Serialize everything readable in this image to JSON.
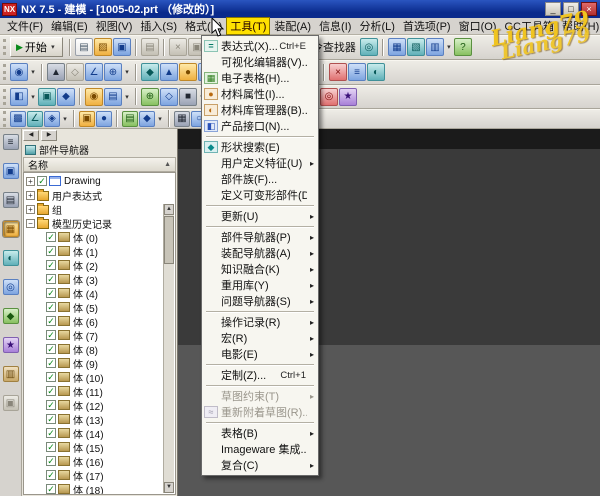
{
  "window": {
    "title": "NX 7.5 - 建模 - [1005-02.prt （修改的）]",
    "logo": "NX",
    "min": "_",
    "max": "□",
    "close": "×"
  },
  "colors": {
    "titlebar_blue": "#0a2a8c",
    "menu_highlight_yellow": "#ffe100",
    "graphics_dark": "#3a3a3a",
    "graphics_light": "#575757",
    "watermark_yellow": "#f0c420"
  },
  "watermark": {
    "text": "Liang79"
  },
  "menu_bar": {
    "items": [
      {
        "id": "file",
        "label": "文件(F)"
      },
      {
        "id": "edit",
        "label": "编辑(E)"
      },
      {
        "id": "view",
        "label": "视图(V)"
      },
      {
        "id": "insert",
        "label": "插入(S)"
      },
      {
        "id": "format",
        "label": "格式(R)"
      },
      {
        "id": "tools",
        "label": "工具(T)",
        "active": true
      },
      {
        "id": "assemblies",
        "label": "装配(A)"
      },
      {
        "id": "information",
        "label": "信息(I)"
      },
      {
        "id": "analysis",
        "label": "分析(L)"
      },
      {
        "id": "preferences",
        "label": "首选项(P)"
      },
      {
        "id": "window",
        "label": "窗口(O)"
      },
      {
        "id": "gc-toolbox",
        "label": "GC工具箱"
      },
      {
        "id": "help",
        "label": "帮助(H)"
      }
    ]
  },
  "tools_menu": {
    "items": [
      {
        "label": "表达式(X)...",
        "shortcut": "Ctrl+E",
        "icon": "expr"
      },
      {
        "label": "可视化编辑器(V)..."
      },
      {
        "label": "电子表格(H)...",
        "icon": "sheet"
      },
      {
        "label": "材料属性(I)...",
        "icon": "material"
      },
      {
        "label": "材料库管理器(B)...",
        "icon": "matlib"
      },
      {
        "label": "产品接口(N)...",
        "icon": "product"
      },
      {
        "sep": true
      },
      {
        "label": "形状搜索(E)",
        "icon": "shape"
      },
      {
        "label": "用户定义特征(U)",
        "sub": true
      },
      {
        "label": "部件族(F)..."
      },
      {
        "label": "定义可变形部件(D)..."
      },
      {
        "sep": true
      },
      {
        "label": "更新(U)",
        "sub": true
      },
      {
        "sep": true
      },
      {
        "label": "部件导航器(P)",
        "sub": true
      },
      {
        "label": "装配导航器(A)",
        "sub": true
      },
      {
        "label": "知识融合(K)",
        "sub": true
      },
      {
        "label": "重用库(Y)",
        "sub": true
      },
      {
        "label": "问题导航器(S)",
        "sub": true
      },
      {
        "sep": true
      },
      {
        "label": "操作记录(R)",
        "sub": true
      },
      {
        "label": "宏(R)",
        "sub": true
      },
      {
        "label": "电影(E)",
        "sub": true
      },
      {
        "sep": true
      },
      {
        "label": "定制(Z)...",
        "shortcut": "Ctrl+1"
      },
      {
        "sep": true
      },
      {
        "label": "草图约束(T)",
        "sub": true,
        "disabled": true
      },
      {
        "label": "重新附着草图(R)...",
        "icon": "reattach",
        "disabled": true
      },
      {
        "sep": true
      },
      {
        "label": "表格(B)",
        "sub": true
      },
      {
        "label": "Imageware 集成..."
      },
      {
        "label": "复合(C)",
        "sub": true
      }
    ]
  },
  "toolbars": {
    "row1": [
      {
        "t": "grip"
      },
      {
        "t": "start",
        "label": "开始",
        "n": "start-button"
      },
      {
        "t": "sep"
      },
      {
        "t": "ic",
        "n": "new-part-icon",
        "c": "c8",
        "g": "▤"
      },
      {
        "t": "ic",
        "n": "open-icon",
        "c": "c1",
        "g": "▨"
      },
      {
        "t": "ic",
        "n": "save-icon",
        "c": "c0",
        "g": "▣"
      },
      {
        "t": "sep"
      },
      {
        "t": "ic",
        "n": "print-icon",
        "c": "c4",
        "g": "▤"
      },
      {
        "t": "sep"
      },
      {
        "t": "ic",
        "n": "cut-icon",
        "c": "c4",
        "g": "×"
      },
      {
        "t": "ic",
        "n": "copy-icon",
        "c": "c4",
        "g": "▣"
      },
      {
        "t": "ic",
        "n": "paste-icon",
        "c": "c4",
        "g": "▥"
      },
      {
        "t": "sep"
      },
      {
        "t": "input",
        "n": "command-finder-input"
      },
      {
        "t": "label",
        "label": "命令查找器",
        "n": "command-finder-label"
      },
      {
        "t": "ic",
        "n": "command-finder-icon",
        "c": "c3",
        "g": "◎"
      },
      {
        "t": "sep"
      },
      {
        "t": "ic",
        "n": "new-window-icon",
        "c": "c0",
        "g": "▦"
      },
      {
        "t": "ic",
        "n": "cascade-windows-icon",
        "c": "c3",
        "g": "▧"
      },
      {
        "t": "ic",
        "n": "tile-windows-icon",
        "c": "c0",
        "g": "▥"
      },
      {
        "t": "car"
      },
      {
        "t": "ic",
        "n": "help-icon",
        "c": "c2",
        "g": "?"
      }
    ],
    "row2": [
      {
        "t": "grip"
      },
      {
        "t": "ic",
        "n": "snap-point-icon",
        "c": "c0",
        "g": "◉"
      },
      {
        "t": "car"
      },
      {
        "t": "sep"
      },
      {
        "t": "ic",
        "n": "select-icon",
        "c": "c9",
        "g": "▲"
      },
      {
        "t": "ic",
        "n": "selection-filter-icon",
        "c": "c4",
        "g": "◇"
      },
      {
        "t": "ic",
        "n": "angle-snap-icon",
        "c": "c0",
        "g": "∠"
      },
      {
        "t": "ic",
        "n": "point-constructor-icon",
        "c": "c0",
        "g": "⊕"
      },
      {
        "t": "car"
      },
      {
        "t": "sep"
      },
      {
        "t": "ic",
        "n": "datum-plane-icon",
        "c": "c3",
        "g": "◆"
      },
      {
        "t": "ic",
        "n": "datum-axis-icon",
        "c": "c0",
        "g": "▲"
      },
      {
        "t": "ic",
        "n": "sphere-icon",
        "c": "c1",
        "g": "●"
      },
      {
        "t": "ic",
        "n": "datum-csys-icon",
        "c": "c0",
        "g": "◧"
      },
      {
        "t": "car"
      },
      {
        "t": "sep"
      },
      {
        "t": "ic",
        "n": "measure-icon",
        "c": "c2",
        "g": "✓"
      },
      {
        "t": "ic",
        "n": "grid-icon",
        "c": "c0",
        "g": "▦"
      },
      {
        "t": "ic",
        "n": "gem-icon",
        "c": "c6",
        "g": "◈"
      },
      {
        "t": "ic",
        "n": "pattern-icon",
        "c": "c0",
        "g": "▩"
      },
      {
        "t": "car"
      },
      {
        "t": "sep"
      },
      {
        "t": "ic",
        "n": "delete-icon",
        "c": "c5",
        "g": "×"
      },
      {
        "t": "ic",
        "n": "list-icon",
        "c": "c0",
        "g": "≡"
      },
      {
        "t": "ic",
        "n": "half-section-icon",
        "c": "c3",
        "g": "◐"
      }
    ],
    "row3": [
      {
        "t": "grip"
      },
      {
        "t": "ic",
        "n": "csys-view-icon",
        "c": "c0",
        "g": "◧"
      },
      {
        "t": "car"
      },
      {
        "t": "ic",
        "n": "shaded-view-icon",
        "c": "c3",
        "g": "▣"
      },
      {
        "t": "ic",
        "n": "wireframe-view-icon",
        "c": "c0",
        "g": "◆"
      },
      {
        "t": "sep"
      },
      {
        "t": "ic",
        "n": "orient-view-icon",
        "c": "c1",
        "g": "◉"
      },
      {
        "t": "ic",
        "n": "fit-view-icon",
        "c": "c0",
        "g": "▤"
      },
      {
        "t": "car"
      },
      {
        "t": "sep"
      },
      {
        "t": "ic",
        "n": "extrude-icon",
        "c": "c2",
        "g": "⊕"
      },
      {
        "t": "ic",
        "n": "revolve-icon",
        "c": "c0",
        "g": "◇"
      },
      {
        "t": "ic",
        "n": "block-icon",
        "c": "c9",
        "g": "■"
      },
      {
        "t": "car"
      },
      {
        "t": "sep"
      },
      {
        "t": "ic",
        "n": "trim-body-icon",
        "c": "c0",
        "g": "▲"
      },
      {
        "t": "ic",
        "n": "unite-icon",
        "c": "c3",
        "g": "●"
      },
      {
        "t": "ic",
        "n": "subtract-icon",
        "c": "c0",
        "g": "▧"
      },
      {
        "t": "sep"
      },
      {
        "t": "ic",
        "n": "edit-feature-icon",
        "c": "c5",
        "g": "◆"
      },
      {
        "t": "ic",
        "n": "delete-face-icon",
        "c": "c5",
        "g": "×"
      },
      {
        "t": "ic",
        "n": "synchronous-icon",
        "c": "c5",
        "g": "◎"
      },
      {
        "t": "ic",
        "n": "move-face-icon",
        "c": "c6",
        "g": "★"
      }
    ],
    "row4": [
      {
        "t": "grip"
      },
      {
        "t": "ic",
        "n": "sketch-icon",
        "c": "c0",
        "g": "▩"
      },
      {
        "t": "ic",
        "n": "sketch-line-icon",
        "c": "c3",
        "g": "∠"
      },
      {
        "t": "ic",
        "n": "sketch-profile-icon",
        "c": "c0",
        "g": "◈"
      },
      {
        "t": "car"
      },
      {
        "t": "sep"
      },
      {
        "t": "ic",
        "n": "arc-icon",
        "c": "c1",
        "g": "▣"
      },
      {
        "t": "ic",
        "n": "circle-icon",
        "c": "c0",
        "g": "●"
      },
      {
        "t": "sep"
      },
      {
        "t": "ic",
        "n": "fillet-icon",
        "c": "c2",
        "g": "▤"
      },
      {
        "t": "ic",
        "n": "chamfer-icon",
        "c": "c0",
        "g": "◆"
      },
      {
        "t": "car"
      },
      {
        "t": "sep"
      },
      {
        "t": "ic",
        "n": "dimension-icon",
        "c": "c9",
        "g": "▦"
      },
      {
        "t": "ic",
        "n": "constraint-icon",
        "c": "c0",
        "g": "○"
      },
      {
        "t": "ic",
        "n": "mirror-icon",
        "c": "c3",
        "g": "▲"
      },
      {
        "t": "ic",
        "n": "stop-icon",
        "c": "c5",
        "g": "●"
      },
      {
        "t": "ic",
        "n": "section-icon",
        "c": "c0",
        "g": "◐"
      }
    ],
    "rail": [
      {
        "n": "resource-bar-toggle-icon",
        "c": "c9",
        "g": "≡"
      },
      {
        "n": "assembly-navigator-tab",
        "c": "c0",
        "g": "▣"
      },
      {
        "n": "constraint-navigator-tab",
        "c": "c9",
        "g": "▤"
      },
      {
        "n": "part-navigator-tab",
        "c": "c1",
        "g": "▦",
        "active": true
      },
      {
        "n": "reuse-library-tab",
        "c": "c3",
        "g": "◐"
      },
      {
        "n": "hd3d-tools-tab",
        "c": "c0",
        "g": "◎"
      },
      {
        "n": "internet-explorer-tab",
        "c": "c2",
        "g": "◆"
      },
      {
        "n": "history-palette-tab",
        "c": "c6",
        "g": "★"
      },
      {
        "n": "system-materials-tab",
        "c": "c7",
        "g": "▥"
      },
      {
        "n": "roles-tab",
        "c": "c4",
        "g": "▣"
      }
    ]
  },
  "navigator": {
    "collapse_left": "◀",
    "collapse_right": "▶",
    "title": "部件导航器",
    "column_header": "名称",
    "sort_glyph": "▲",
    "scroll_up": "▲",
    "scroll_down": "▼",
    "items": [
      {
        "label": "Drawing",
        "icon": "drawing",
        "check": true,
        "exp": "plus"
      },
      {
        "label": "用户表达式",
        "icon": "folder",
        "exp": "plus"
      },
      {
        "label": "组",
        "icon": "folder",
        "exp": "plus"
      },
      {
        "label": "模型历史记录",
        "icon": "folder",
        "exp": "minus"
      },
      {
        "label": "体 (0)",
        "icon": "body",
        "check": true,
        "child": true
      },
      {
        "label": "体 (1)",
        "icon": "body",
        "check": true,
        "child": true
      },
      {
        "label": "体 (2)",
        "icon": "body",
        "check": true,
        "child": true
      },
      {
        "label": "体 (3)",
        "icon": "body",
        "check": true,
        "child": true
      },
      {
        "label": "体 (4)",
        "icon": "body",
        "check": true,
        "child": true
      },
      {
        "label": "体 (5)",
        "icon": "body",
        "check": true,
        "child": true
      },
      {
        "label": "体 (6)",
        "icon": "body",
        "check": true,
        "child": true
      },
      {
        "label": "体 (7)",
        "icon": "body",
        "check": true,
        "child": true
      },
      {
        "label": "体 (8)",
        "icon": "body",
        "check": true,
        "child": true
      },
      {
        "label": "体 (9)",
        "icon": "body",
        "check": true,
        "child": true
      },
      {
        "label": "体 (10)",
        "icon": "body",
        "check": true,
        "child": true
      },
      {
        "label": "体 (11)",
        "icon": "body",
        "check": true,
        "child": true
      },
      {
        "label": "体 (12)",
        "icon": "body",
        "check": true,
        "child": true
      },
      {
        "label": "体 (13)",
        "icon": "body",
        "check": true,
        "child": true
      },
      {
        "label": "体 (14)",
        "icon": "body",
        "check": true,
        "child": true
      },
      {
        "label": "体 (15)",
        "icon": "body",
        "check": true,
        "child": true
      },
      {
        "label": "体 (16)",
        "icon": "body",
        "check": true,
        "child": true
      },
      {
        "label": "体 (17)",
        "icon": "body",
        "check": true,
        "child": true
      },
      {
        "label": "体 (18)",
        "icon": "body",
        "check": true,
        "child": true
      }
    ]
  }
}
